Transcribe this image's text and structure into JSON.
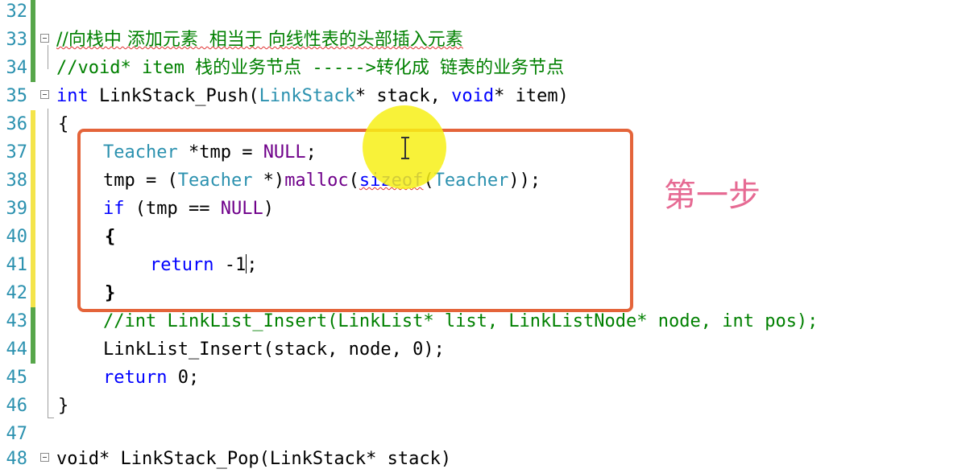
{
  "editor": {
    "lines": [
      {
        "num": "32",
        "text": ""
      },
      {
        "num": "33",
        "text": "//向栈中 添加元素  相当于 向线性表的头部插入元素"
      },
      {
        "num": "34",
        "text": "//void* item 栈的业务节点 ----->转化成 链表的业务节点"
      },
      {
        "num": "35",
        "kw": "int",
        "rest": " LinkStack_Push(",
        "ty1": "LinkStack",
        "rest2": "* stack, ",
        "kw2": "void",
        "rest3": "* item)"
      },
      {
        "num": "36",
        "text": "{"
      },
      {
        "num": "37",
        "ty": "Teacher",
        "rest": " *tmp = ",
        "mac": "NULL",
        "rest2": ";"
      },
      {
        "num": "38",
        "pre": "tmp = (",
        "ty": "Teacher",
        "mid": " *)",
        "mac": "malloc",
        "mid2": "(",
        "kw": "sizeof",
        "mid3": "(",
        "ty2": "Teacher",
        "end": "));"
      },
      {
        "num": "39",
        "kw": "if",
        "rest": " (tmp == ",
        "mac": "NULL",
        "rest2": ")"
      },
      {
        "num": "40",
        "text": "{"
      },
      {
        "num": "41",
        "kw": "return",
        "rest": " -1",
        "rest2": ";"
      },
      {
        "num": "42",
        "text": "}"
      },
      {
        "num": "43",
        "text": "//int LinkList_Insert(LinkList* list, LinkListNode* node, int pos);"
      },
      {
        "num": "44",
        "text": "LinkList_Insert(stack, node, 0);"
      },
      {
        "num": "45",
        "kw": "return",
        "rest": " 0;"
      },
      {
        "num": "46",
        "text": "}"
      },
      {
        "num": "47",
        "text": ""
      },
      {
        "num": "48",
        "text": "void* LinkStack_Pop(LinkStack* stack)"
      }
    ]
  },
  "annotation": {
    "text": "第一步",
    "color": "#e66a93"
  },
  "colors": {
    "keyword": "#0000ff",
    "type": "#2b91af",
    "macro": "#6f008a",
    "comment": "#008000",
    "box": "#e4643a",
    "cursor_spot": "#f7f016"
  },
  "icons": {
    "fold": "collapse-box-icon",
    "cursor": "ibeam-cursor-icon"
  }
}
